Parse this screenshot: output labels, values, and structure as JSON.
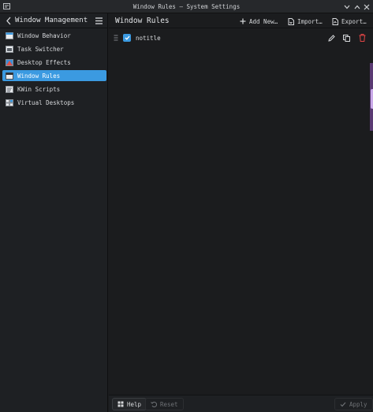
{
  "window": {
    "title": "Window Rules — System Settings"
  },
  "sidebar": {
    "heading": "Window Management",
    "items": [
      {
        "label": "Window Behavior",
        "icon": "window-behavior-icon",
        "active": false
      },
      {
        "label": "Task Switcher",
        "icon": "task-switcher-icon",
        "active": false
      },
      {
        "label": "Desktop Effects",
        "icon": "desktop-effects-icon",
        "active": false
      },
      {
        "label": "Window Rules",
        "icon": "window-rules-icon",
        "active": true
      },
      {
        "label": "KWin Scripts",
        "icon": "kwin-scripts-icon",
        "active": false
      },
      {
        "label": "Virtual Desktops",
        "icon": "virtual-desktops-icon",
        "active": false
      }
    ]
  },
  "main": {
    "title": "Window Rules",
    "actions": {
      "add_new": "Add New…",
      "import": "Import…",
      "export": "Export…"
    },
    "rules": [
      {
        "label": "notitle",
        "enabled": true
      }
    ]
  },
  "footer": {
    "help": "Help",
    "reset": "Reset",
    "apply": "Apply"
  },
  "colors": {
    "accent": "#3b9ae1",
    "background": "#1b1c1e",
    "delete": "#e04545"
  }
}
